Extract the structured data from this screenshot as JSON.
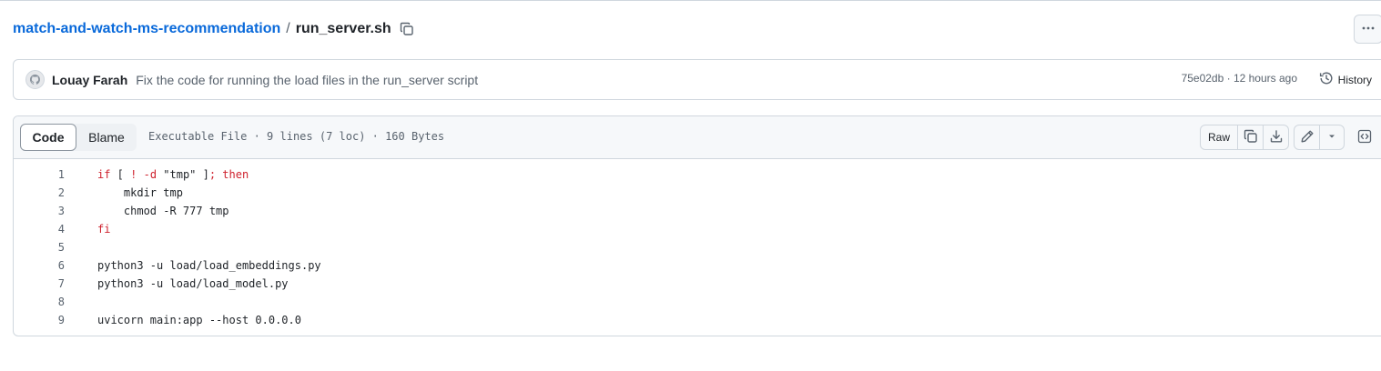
{
  "breadcrumb": {
    "repo": "match-and-watch-ms-recommendation",
    "separator": "/",
    "file": "run_server.sh"
  },
  "commit": {
    "author": "Louay Farah",
    "message": "Fix the code for running the load files in the run_server script",
    "meta": "75e02db · 12 hours ago",
    "history_label": "History"
  },
  "file_header": {
    "tabs": [
      "Code",
      "Blame"
    ],
    "active_tab": "Code",
    "info": "Executable File · 9 lines (7 loc) · 160 Bytes",
    "raw_label": "Raw"
  },
  "code_lines": [
    {
      "num": "1",
      "tokens": [
        {
          "t": "if",
          "k": 1
        },
        {
          "t": " [ ",
          "k": 0
        },
        {
          "t": "!",
          "k": 1
        },
        {
          "t": " ",
          "k": 0
        },
        {
          "t": "-d",
          "k": 1
        },
        {
          "t": " \"tmp\" ]",
          "k": 0
        },
        {
          "t": "; then",
          "k": 1
        }
      ]
    },
    {
      "num": "2",
      "tokens": [
        {
          "t": "    mkdir tmp",
          "k": 0
        }
      ]
    },
    {
      "num": "3",
      "tokens": [
        {
          "t": "    chmod -R 777 tmp",
          "k": 0
        }
      ]
    },
    {
      "num": "4",
      "tokens": [
        {
          "t": "fi",
          "k": 1
        }
      ]
    },
    {
      "num": "5",
      "tokens": []
    },
    {
      "num": "6",
      "tokens": [
        {
          "t": "python3 -u load/load_embeddings.py",
          "k": 0
        }
      ]
    },
    {
      "num": "7",
      "tokens": [
        {
          "t": "python3 -u load/load_model.py",
          "k": 0
        }
      ]
    },
    {
      "num": "8",
      "tokens": []
    },
    {
      "num": "9",
      "tokens": [
        {
          "t": "uvicorn main:app --host 0.0.0.0",
          "k": 0
        }
      ]
    }
  ],
  "icons": {
    "copy_path": "copy-icon",
    "more": "kebab-horizontal-icon",
    "history": "history-icon",
    "copy_raw": "copy-icon",
    "download": "download-icon",
    "edit": "pencil-icon",
    "dropdown": "triangle-down-icon",
    "symbols": "code-square-icon"
  },
  "colors": {
    "link": "#0969da",
    "keyword": "#cf222e",
    "muted": "#59636e",
    "border": "#d0d7de"
  }
}
